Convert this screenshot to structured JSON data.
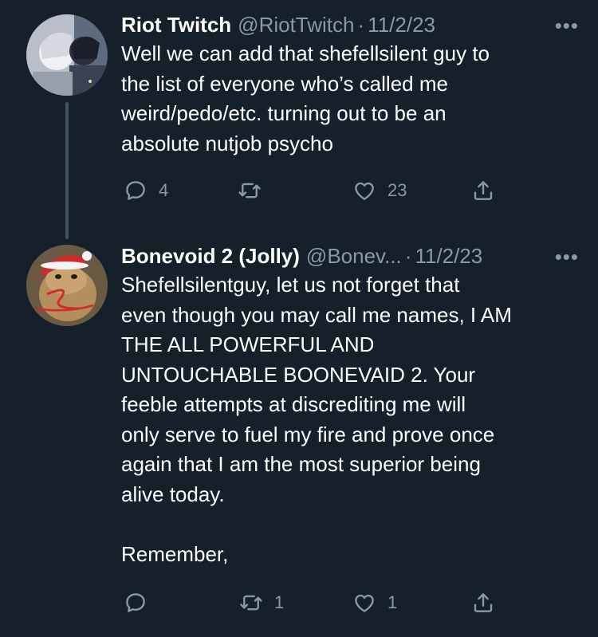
{
  "tweets": [
    {
      "name": "Riot Twitch",
      "handle": "@RiotTwitch",
      "dot": "·",
      "date": "11/2/23",
      "more": "•••",
      "text": "Well we can add that shefellsilent guy to\nthe list of everyone who’s called me\nweird/pedo/etc. turning out to be an\nabsolute nutjob psycho",
      "reply_count": "4",
      "retweet_count": "",
      "like_count": "23"
    },
    {
      "name": "Bonevoid 2 (Jolly)",
      "handle": "@Bonev...",
      "dot": "·",
      "date": "11/2/23",
      "more": "•••",
      "text": "Shefellsilentguy, let us not forget that\neven though you may call me names, I AM\nTHE ALL POWERFUL AND\nUNTOUCHABLE BOONEVAID 2. Your\nfeeble attempts at discrediting me will\nonly serve to fuel my fire and prove once\nagain that I am the most superior being\nalive today.\n\nRemember,",
      "reply_count": "",
      "retweet_count": "1",
      "like_count": "1"
    }
  ],
  "colors": {
    "background": "#15202b",
    "secondary_text": "#8b98a5",
    "thread_line": "#425364"
  },
  "icons": [
    "reply-icon",
    "retweet-icon",
    "like-icon",
    "share-icon",
    "more-icon"
  ]
}
